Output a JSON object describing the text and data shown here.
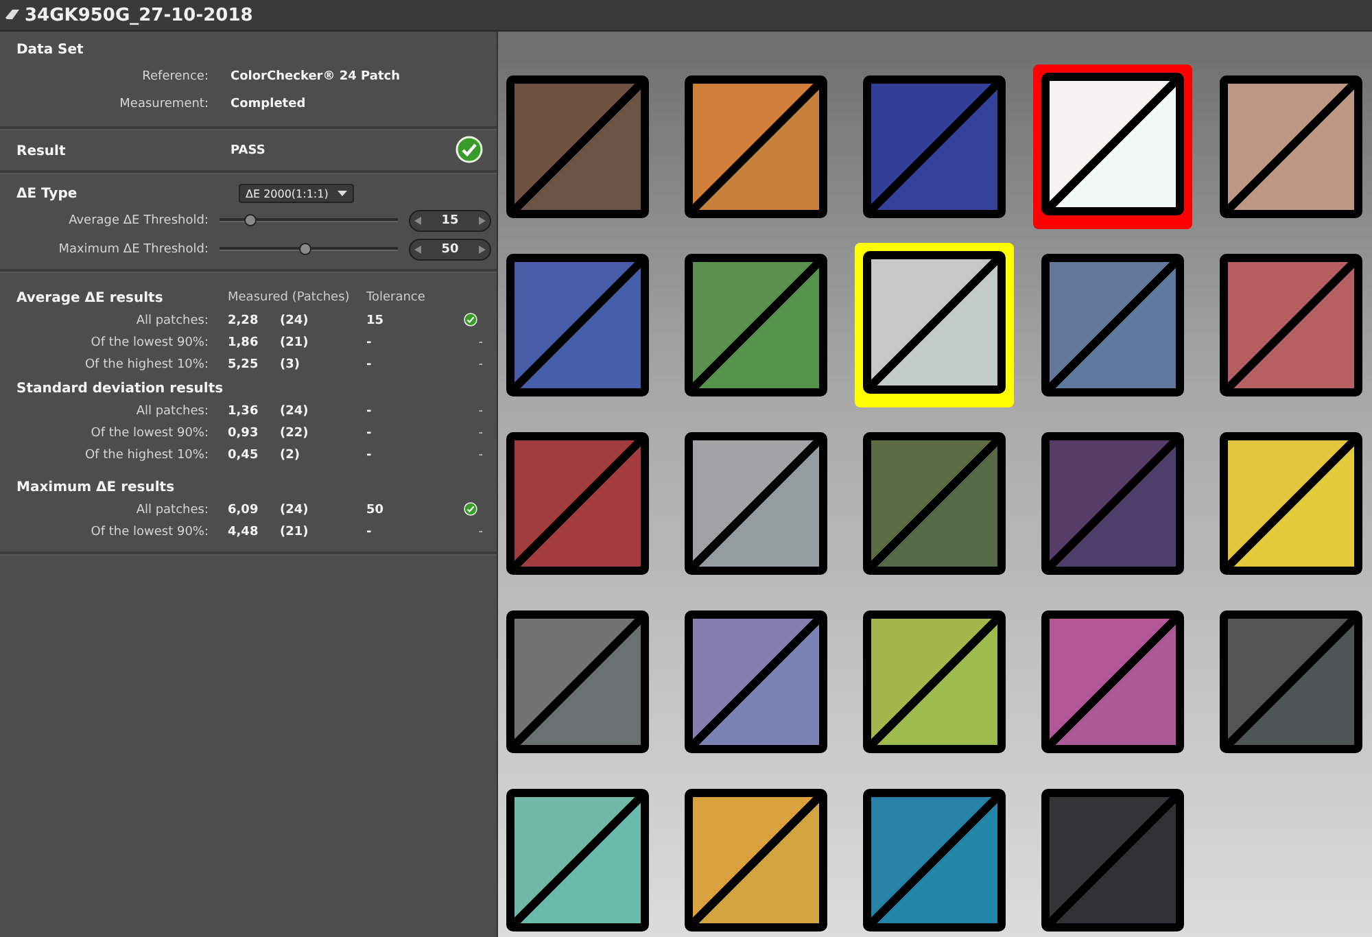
{
  "window": {
    "title": "34GK950G_27-10-2018"
  },
  "data_set": {
    "heading": "Data Set",
    "fields": [
      {
        "label": "Reference:",
        "value": "ColorChecker® 24 Patch"
      },
      {
        "label": "Measurement:",
        "value": "Completed"
      }
    ]
  },
  "result": {
    "label": "Result",
    "value": "PASS",
    "passed": true
  },
  "de_type": {
    "label": "ΔE Type",
    "dropdown": "ΔE 2000(1:1:1)",
    "thresholds": [
      {
        "label": "Average  ΔE Threshold:",
        "level": 0.17,
        "value": "15"
      },
      {
        "label": "Maximum ΔE Threshold:",
        "level": 0.48,
        "value": "50"
      }
    ]
  },
  "results": {
    "columns": [
      "Measured (Patches)",
      "Tolerance"
    ],
    "groups": [
      {
        "heading": "Average ΔE results",
        "rows": [
          {
            "label": "All patches:",
            "measured": "2,28",
            "patches": "(24)",
            "tolerance": "15",
            "passed": true
          },
          {
            "label": "Of the lowest 90%:",
            "measured": "1,86",
            "patches": "(21)",
            "tolerance": "-",
            "passed": false,
            "status": "-"
          },
          {
            "label": "Of the highest 10%:",
            "measured": "5,25",
            "patches": "(3)",
            "tolerance": "-",
            "passed": false,
            "status": "-"
          }
        ]
      },
      {
        "heading": "Standard deviation results",
        "rows": [
          {
            "label": "All patches:",
            "measured": "1,36",
            "patches": "(24)",
            "tolerance": "-",
            "passed": false,
            "status": "-"
          },
          {
            "label": "Of the lowest 90%:",
            "measured": "0,93",
            "patches": "(22)",
            "tolerance": "-",
            "passed": false,
            "status": "-"
          },
          {
            "label": "Of the highest 10%:",
            "measured": "0,45",
            "patches": "(2)",
            "tolerance": "-",
            "passed": false,
            "status": "-"
          }
        ]
      },
      {
        "heading": "Maximum ΔE results",
        "rows": [
          {
            "label": "All patches:",
            "measured": "6,09",
            "patches": "(24)",
            "tolerance": "50",
            "passed": true
          },
          {
            "label": "Of the lowest 90%:",
            "measured": "4,48",
            "patches": "(21)",
            "tolerance": "-",
            "passed": false,
            "status": "-"
          }
        ]
      }
    ]
  },
  "patches": [
    {
      "halves": [
        {
          "color": "#6d5242"
        },
        {
          "color": "#6a5445"
        }
      ],
      "worst": false,
      "best": false
    },
    {
      "halves": [
        {
          "color": "#cf7f3a"
        },
        {
          "color": "#c67f3a"
        }
      ],
      "worst": false,
      "best": false
    },
    {
      "halves": [
        {
          "color": "#333f97"
        },
        {
          "color": "#33419a"
        }
      ],
      "worst": false,
      "best": false
    },
    {
      "halves": [
        {
          "color": "#f3f2ee"
        },
        {
          "color": "#f2f8f6"
        }
      ],
      "worst": true,
      "best": false
    },
    {
      "halves": [
        {
          "color": "#bc9885"
        },
        {
          "color": "#bc9884"
        }
      ],
      "worst": false,
      "best": false
    },
    {
      "halves": [
        {
          "color": "#4a5ca8"
        },
        {
          "color": "#475fab"
        }
      ],
      "worst": false,
      "best": false
    },
    {
      "halves": [
        {
          "color": "#5a904d"
        },
        {
          "color": "#55924a"
        }
      ],
      "worst": false,
      "best": false
    },
    {
      "halves": [
        {
          "color": "#c6c8c5"
        },
        {
          "color": "#c3cbc9"
        }
      ],
      "worst": false,
      "best": true
    },
    {
      "halves": [
        {
          "color": "#637899"
        },
        {
          "color": "#5f799d"
        }
      ],
      "worst": false,
      "best": false
    },
    {
      "halves": [
        {
          "color": "#b65f62"
        },
        {
          "color": "#b66065"
        }
      ],
      "worst": false,
      "best": false
    },
    {
      "halves": [
        {
          "color": "#a23b3e"
        },
        {
          "color": "#a33b3f"
        }
      ],
      "worst": false,
      "best": false
    },
    {
      "halves": [
        {
          "color": "#a0a2a3"
        },
        {
          "color": "#979ea2"
        }
      ],
      "worst": false,
      "best": false
    },
    {
      "halves": [
        {
          "color": "#5d6c45"
        },
        {
          "color": "#576a47"
        }
      ],
      "worst": false,
      "best": false
    },
    {
      "halves": [
        {
          "color": "#583c68"
        },
        {
          "color": "#4e3f6a"
        }
      ],
      "worst": false,
      "best": false
    },
    {
      "halves": [
        {
          "color": "#e2c63e"
        },
        {
          "color": "#e2ca3c"
        }
      ],
      "worst": false,
      "best": false
    },
    {
      "halves": [
        {
          "color": "#717372"
        },
        {
          "color": "#6b7170"
        }
      ],
      "worst": false,
      "best": false
    },
    {
      "halves": [
        {
          "color": "#837ead"
        },
        {
          "color": "#7b82b4"
        }
      ],
      "worst": false,
      "best": false
    },
    {
      "halves": [
        {
          "color": "#a1b74d"
        },
        {
          "color": "#9cbb4c"
        }
      ],
      "worst": false,
      "best": false
    },
    {
      "halves": [
        {
          "color": "#b25895"
        },
        {
          "color": "#ab5a95"
        }
      ],
      "worst": false,
      "best": false
    },
    {
      "halves": [
        {
          "color": "#545654"
        },
        {
          "color": "#4e5554"
        }
      ],
      "worst": false,
      "best": false
    },
    {
      "halves": [
        {
          "color": "#72b8a6"
        },
        {
          "color": "#68bbab"
        }
      ],
      "worst": false,
      "best": false
    },
    {
      "halves": [
        {
          "color": "#d9a23d"
        },
        {
          "color": "#d3a540"
        }
      ],
      "worst": false,
      "best": false
    },
    {
      "halves": [
        {
          "color": "#2982a5"
        },
        {
          "color": "#2185aa"
        }
      ],
      "worst": false,
      "best": false
    },
    {
      "halves": [
        {
          "color": "#343536"
        },
        {
          "color": "#2f3336"
        }
      ],
      "worst": false,
      "best": false
    }
  ]
}
